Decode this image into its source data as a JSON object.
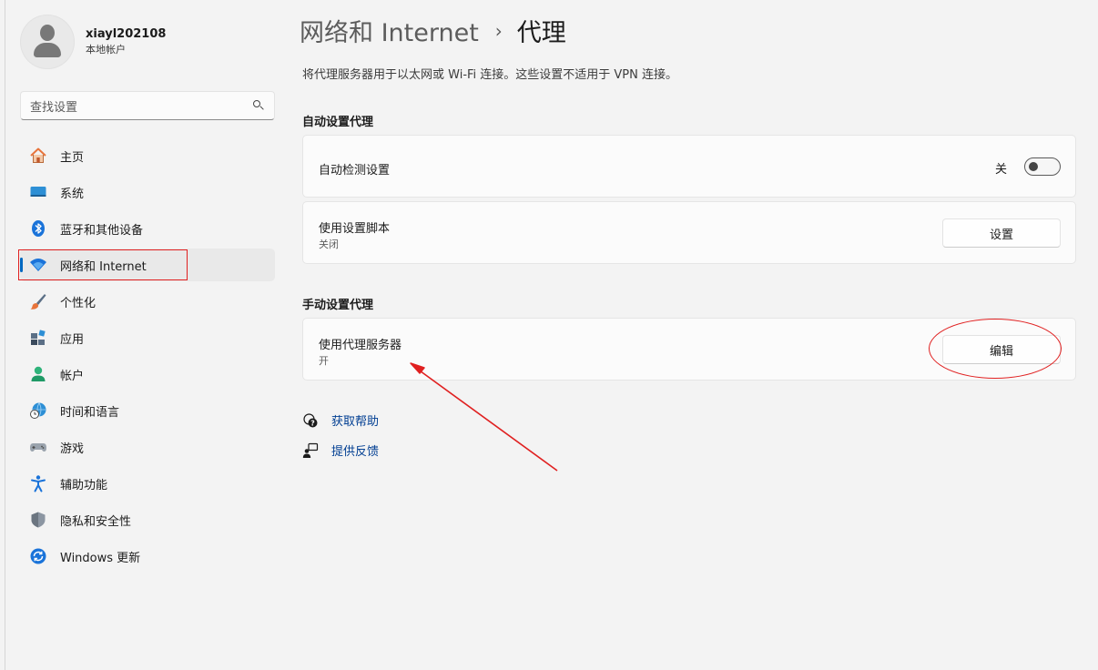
{
  "sidebar": {
    "profile": {
      "name": "xiayl202108",
      "account_type": "本地帐户"
    },
    "search": {
      "placeholder": "查找设置",
      "icon": "search-icon"
    },
    "items": [
      {
        "label": "主页",
        "icon": "home-icon"
      },
      {
        "label": "系统",
        "icon": "system-icon"
      },
      {
        "label": "蓝牙和其他设备",
        "icon": "bluetooth-icon"
      },
      {
        "label": "网络和 Internet",
        "icon": "wifi-icon",
        "selected": true
      },
      {
        "label": "个性化",
        "icon": "brush-icon"
      },
      {
        "label": "应用",
        "icon": "apps-icon"
      },
      {
        "label": "帐户",
        "icon": "account-icon"
      },
      {
        "label": "时间和语言",
        "icon": "time-language-icon"
      },
      {
        "label": "游戏",
        "icon": "gamepad-icon"
      },
      {
        "label": "辅助功能",
        "icon": "accessibility-icon"
      },
      {
        "label": "隐私和安全性",
        "icon": "shield-icon"
      },
      {
        "label": "Windows 更新",
        "icon": "update-icon"
      }
    ]
  },
  "header": {
    "parent": "网络和 Internet",
    "separator": "›",
    "current": "代理"
  },
  "description": "将代理服务器用于以太网或 Wi-Fi 连接。这些设置不适用于 VPN 连接。",
  "auto_proxy": {
    "section_title": "自动设置代理",
    "detect": {
      "title": "自动检测设置",
      "state_label": "关",
      "enabled": false
    },
    "script": {
      "title": "使用设置脚本",
      "status": "关闭",
      "button_label": "设置"
    }
  },
  "manual_proxy": {
    "section_title": "手动设置代理",
    "server": {
      "title": "使用代理服务器",
      "status": "开",
      "button_label": "编辑"
    }
  },
  "links": {
    "help": {
      "label": "获取帮助",
      "icon": "help-icon"
    },
    "feedback": {
      "label": "提供反馈",
      "icon": "feedback-icon"
    }
  },
  "colors": {
    "accent": "#0067c0",
    "annotation": "#e02020",
    "link": "#003e92"
  }
}
